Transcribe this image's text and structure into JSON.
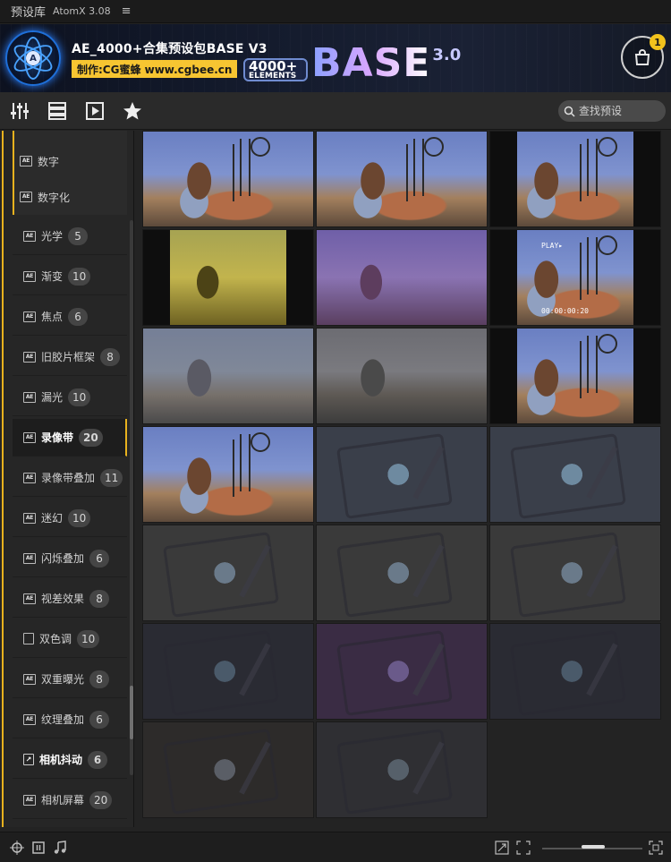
{
  "app": {
    "title": "预设库",
    "subtitle": "AtomX 3.08",
    "menu_icon": "hamburger-icon"
  },
  "banner": {
    "title": "AE_4000+合集预设包BASE V3",
    "maker": "制作:CG蜜蜂 www.cgbee.cn",
    "elements_big": "4000+",
    "elements_small": "ELEMENTS",
    "base_word": "BASE",
    "base_version": "3.0",
    "cart_count": "1",
    "logo_letter": "A",
    "accent_color": "#f7c531"
  },
  "toolbar": {
    "icons": [
      "sliders-icon",
      "list-icon",
      "play-file-icon",
      "star-icon"
    ],
    "search_placeholder": "查找预设"
  },
  "sidebar": {
    "sub_items": [
      {
        "label": "数字"
      },
      {
        "label": "数字化"
      }
    ],
    "categories": [
      {
        "label": "光学",
        "count": "5"
      },
      {
        "label": "渐变",
        "count": "10"
      },
      {
        "label": "焦点",
        "count": "6"
      },
      {
        "label": "旧胶片框架",
        "count": "8"
      },
      {
        "label": "漏光",
        "count": "10"
      },
      {
        "label": "录像带",
        "count": "20",
        "active": true
      },
      {
        "label": "录像带叠加",
        "count": "11"
      },
      {
        "label": "迷幻",
        "count": "10"
      },
      {
        "label": "闪烁叠加",
        "count": "6"
      },
      {
        "label": "视差效果",
        "count": "8"
      },
      {
        "label": "双色调",
        "count": "10"
      },
      {
        "label": "双重曝光",
        "count": "8"
      },
      {
        "label": "纹理叠加",
        "count": "6"
      },
      {
        "label": "相机抖动",
        "count": "6"
      },
      {
        "label": "相机屏幕",
        "count": "20"
      }
    ]
  },
  "grid": {
    "osd_play": "PLAY▸",
    "osd_time": "00:00:00:20"
  },
  "statusbar": {
    "left_icons": [
      "target-icon",
      "pause-icon",
      "music-note-icon"
    ],
    "right_icons": [
      "expand-icon",
      "fit-icon",
      "fullscreen-icon"
    ]
  }
}
